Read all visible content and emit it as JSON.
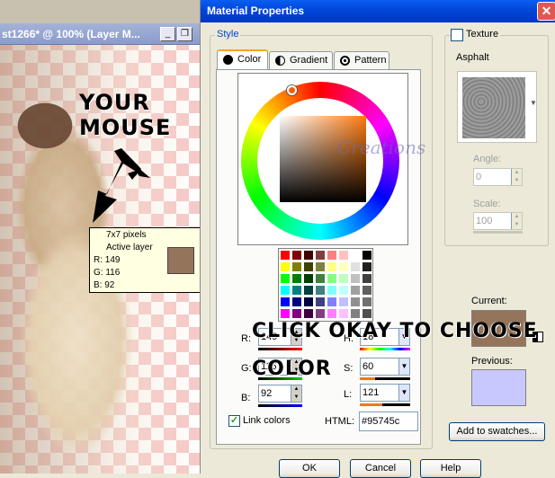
{
  "background_window": {
    "title": "st1266* @ 100% (Layer M...",
    "minimize": "_",
    "restore": "❐"
  },
  "annotations": {
    "mouse_label": "YOUR MOUSE",
    "click_label_line1": "CLICK OKAY TO CHOOSE",
    "click_label_line2": "COLOR"
  },
  "tooltip": {
    "size": "7x7 pixels",
    "layer": "Active layer",
    "r": "R: 149",
    "g": "G: 116",
    "b": "B: 92",
    "swatch_color": "#95745c"
  },
  "dialog": {
    "title": "Material Properties",
    "close": "✕",
    "style_legend": "Style",
    "tabs": [
      {
        "label": "Color",
        "active": true
      },
      {
        "label": "Gradient",
        "active": false
      },
      {
        "label": "Pattern",
        "active": false
      }
    ],
    "watermark": "Creations",
    "fields": {
      "r_label": "R:",
      "r_value": "149",
      "h_label": "H:",
      "h_value": "18",
      "g_label": "G:",
      "g_value": "116",
      "s_label": "S:",
      "s_value": "60",
      "b_label": "B:",
      "b_value": "92",
      "l_label": "L:",
      "l_value": "121"
    },
    "link_colors_label": "Link colors",
    "link_colors_checked": true,
    "html_label": "HTML:",
    "html_value": "#95745c",
    "texture": {
      "checkbox_label": "Texture",
      "name": "Asphalt",
      "angle_label": "Angle:",
      "angle_value": "0",
      "scale_label": "Scale:",
      "scale_value": "100"
    },
    "current_label": "Current:",
    "current_color": "#95745c",
    "previous_label": "Previous:",
    "previous_color": "#c8c8ff",
    "add_to_swatches": "Add to swatches...",
    "ok": "OK",
    "cancel": "Cancel",
    "help": "Help"
  },
  "swatch_palette": [
    [
      "#ff0000",
      "#800000",
      "#400000",
      "#804040",
      "#ff8080",
      "#ffc0c0",
      "#ffffff",
      "#000000"
    ],
    [
      "#ffff00",
      "#808000",
      "#404000",
      "#808040",
      "#ffff80",
      "#ffffc0",
      "#e0e0e0",
      "#202020"
    ],
    [
      "#00ff00",
      "#008000",
      "#004000",
      "#408040",
      "#80ff80",
      "#c0ffc0",
      "#c0c0c0",
      "#404040"
    ],
    [
      "#00ffff",
      "#008080",
      "#004040",
      "#408080",
      "#80ffff",
      "#c0ffff",
      "#a0a0a0",
      "#606060"
    ],
    [
      "#0000ff",
      "#000080",
      "#000040",
      "#404080",
      "#8080ff",
      "#c0c0ff",
      "#909090",
      "#707070"
    ],
    [
      "#ff00ff",
      "#800080",
      "#400040",
      "#804080",
      "#ff80ff",
      "#ffc0ff",
      "#808080",
      "#505050"
    ]
  ]
}
